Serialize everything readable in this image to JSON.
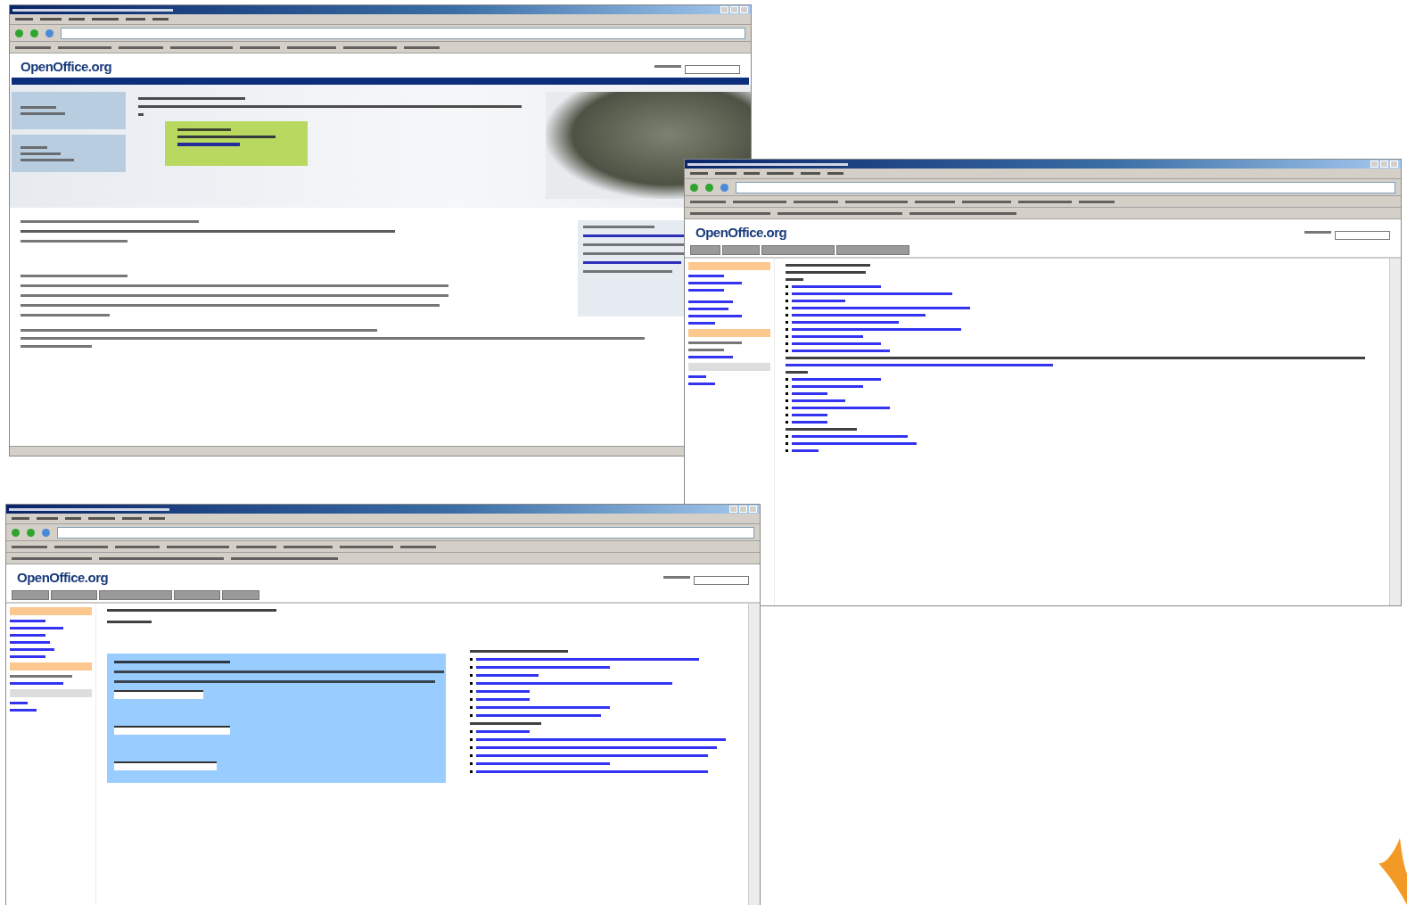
{
  "windows": [
    {
      "kind": "home",
      "logo": "OpenOffice.org"
    },
    {
      "kind": "wiki",
      "logo": "OpenOffice.org"
    },
    {
      "kind": "form",
      "logo": "OpenOffice.org"
    }
  ]
}
